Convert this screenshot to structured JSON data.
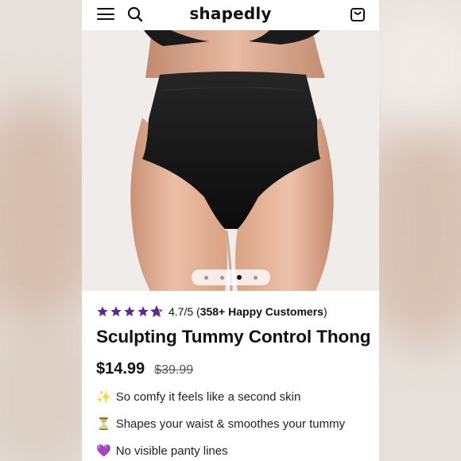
{
  "header": {
    "logo_text": "shapedly",
    "menu_icon": "hamburger-menu-icon",
    "search_icon": "search-icon",
    "cart_icon": "shopping-bag-icon"
  },
  "gallery": {
    "slide_count": 4,
    "active_slide": 3
  },
  "product": {
    "rating": {
      "stars_filled": 4.7,
      "stars_total": 5,
      "score": "4.7/5",
      "open_paren": " (",
      "customers": "358+ Happy Customers",
      "close_paren": ")"
    },
    "title": "Sculpting Tummy Control Thong",
    "price": "$14.99",
    "compare_at_price": "$39.99",
    "benefits": [
      {
        "emoji": "✨",
        "text": "So comfy it feels like a second skin"
      },
      {
        "emoji": "⏳",
        "text": "Shapes your waist & smoothes your tummy"
      },
      {
        "emoji": "💜",
        "text": "No visible panty lines"
      }
    ]
  },
  "colors": {
    "accent_star": "#5b2d86",
    "text": "#111111",
    "background": "#ffffff"
  }
}
